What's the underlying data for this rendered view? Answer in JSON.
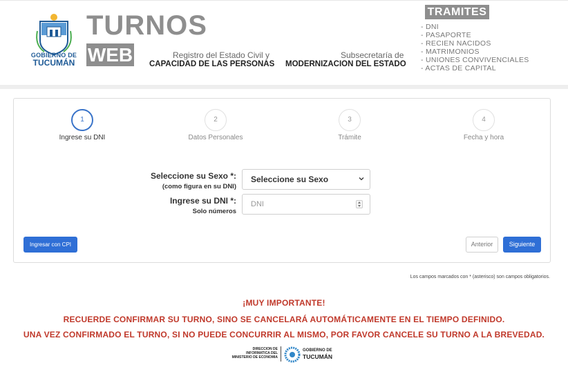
{
  "header": {
    "logo_line1": "GOBIERNO DE",
    "logo_line2": "TUCUMÁN",
    "app_title": "TURNOS",
    "app_subtitle": "WEB",
    "registro_line1": "Registro del Estado Civil y",
    "registro_line2": "CAPACIDAD DE LAS PERSONAS",
    "subsecretaria_line1": "Subsecretaría de",
    "subsecretaria_line2": "MODERNIZACION DEL ESTADO",
    "tramites_title": "TRAMITES",
    "tramites": [
      "- DNI",
      "- PASAPORTE",
      "- RECIEN NACIDOS",
      "- MATRIMONIOS",
      "- UNIONES CONVIVENCIALES",
      "- ACTAS DE CAPITAL"
    ]
  },
  "steps": [
    {
      "number": "1",
      "label": "Ingrese su DNI",
      "active": true
    },
    {
      "number": "2",
      "label": "Datos Personales",
      "active": false
    },
    {
      "number": "3",
      "label": "Trámite",
      "active": false
    },
    {
      "number": "4",
      "label": "Fecha y hora",
      "active": false
    }
  ],
  "form": {
    "sexo_label": "Seleccione su Sexo *:",
    "sexo_hint": "(como figura en su DNI)",
    "sexo_value": "Seleccione su Sexo",
    "dni_label": "Ingrese su DNI *:",
    "dni_hint": "Solo números",
    "dni_placeholder": "DNI"
  },
  "buttons": {
    "cpi": "Ingresar con CPI",
    "anterior": "Anterior",
    "siguiente": "Siguiente"
  },
  "notice_required": "Los campos marcados con * (asterisco) son campos obligatorios.",
  "important": {
    "title": "¡MUY IMPORTANTE!",
    "line1": "RECUERDE CONFIRMAR SU TURNO, SINO SE CANCELARÁ AUTOMÁTICAMENTE EN EL TIEMPO DEFINIDO.",
    "line2": "UNA VEZ CONFIRMADO EL TURNO, SI NO PUEDE CONCURRIR AL MISMO, POR FAVOR CANCELE SU TURNO A LA BREVEDAD."
  },
  "footer": {
    "direccion_line1": "DIRECCION DE",
    "direccion_line2": "INFORMATICA DEL",
    "direccion_line3": "MINISTERIO DE ECONOMIA",
    "gob_line1": "GOBIERNO DE",
    "gob_line2": "TUCUMÁN"
  },
  "colors": {
    "primary": "#2f6fd6",
    "header_gray": "#8e8e8e",
    "important_red": "#c0392b",
    "logo_blue": "#1e5a96"
  }
}
